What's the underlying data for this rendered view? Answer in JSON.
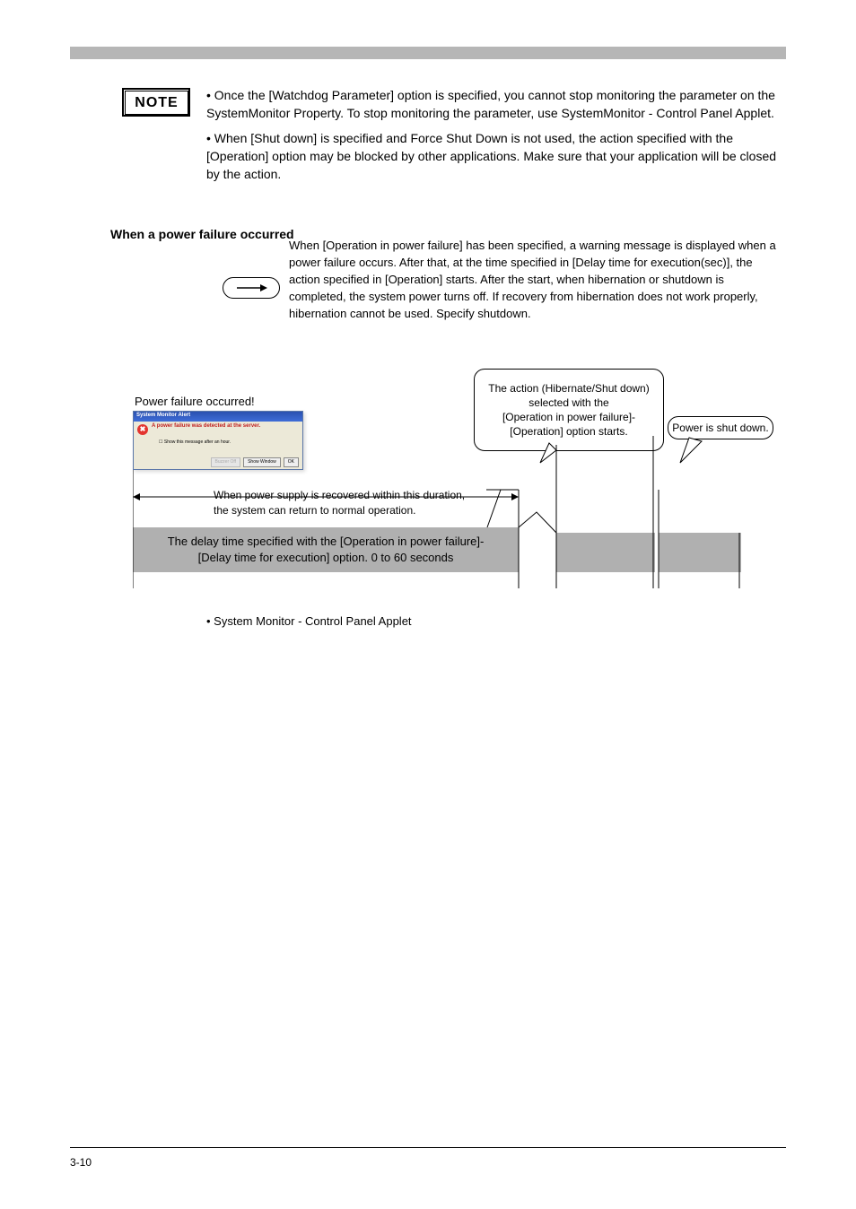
{
  "header": {},
  "note": {
    "label": "NOTE",
    "paragraphs": [
      "• Once the [Watchdog Parameter] option is specified, you cannot stop monitoring the parameter on the SystemMonitor Property. To stop monitoring the parameter, use SystemMonitor - Control Panel Applet.",
      "• When [Shut down] is specified and Force Shut Down is not used, the action specified with the [Operation] option may be blocked by other applications. Make sure that your application will be closed by the action."
    ]
  },
  "powerfail": {
    "title": "When a power failure occurred",
    "description": "When [Operation in power failure] has been specified, a warning message is displayed when a power failure occurs. After that, at the time specified in [Delay time for execution(sec)], the action specified in [Operation] starts. After the start, when hibernation or shutdown is completed, the system power turns off. If recovery from hibernation does not work properly, hibernation cannot be used. Specify shutdown.",
    "diagram": {
      "occurred_label": "Power failure occurred!",
      "window": {
        "title": "System Monitor Alert",
        "message": "A power failure was detected at the server.",
        "checkbox": "Show this message after an hour.",
        "buzzer_btn": "Buzzer Off",
        "show_btn": "Show Window",
        "ok_btn": "OK"
      },
      "bubble_action": "The action (Hibernate/Shut down) selected with the\n[Operation in power failure]-\n[Operation] option starts.",
      "bubble_power": "Power is shut down.",
      "recovery_line1": "When power supply is recovered within this duration,",
      "recovery_line2": "the system can return to normal operation.",
      "delay_line1": "The delay time specified with the [Operation in power failure]-",
      "delay_line2": "[Delay time for execution] option. 0 to 60 seconds"
    }
  },
  "cross_ref": "•  System Monitor - Control Panel Applet",
  "footer": {
    "page_number": "3-10",
    "text": ""
  }
}
